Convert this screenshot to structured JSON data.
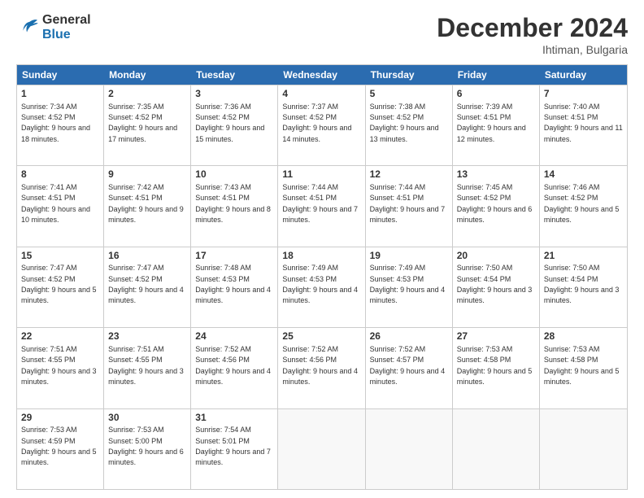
{
  "logo": {
    "line1": "General",
    "line2": "Blue"
  },
  "title": "December 2024",
  "location": "Ihtiman, Bulgaria",
  "days_of_week": [
    "Sunday",
    "Monday",
    "Tuesday",
    "Wednesday",
    "Thursday",
    "Friday",
    "Saturday"
  ],
  "weeks": [
    [
      {
        "day": "1",
        "sunrise": "7:34 AM",
        "sunset": "4:52 PM",
        "daylight": "9 hours and 18 minutes."
      },
      {
        "day": "2",
        "sunrise": "7:35 AM",
        "sunset": "4:52 PM",
        "daylight": "9 hours and 17 minutes."
      },
      {
        "day": "3",
        "sunrise": "7:36 AM",
        "sunset": "4:52 PM",
        "daylight": "9 hours and 15 minutes."
      },
      {
        "day": "4",
        "sunrise": "7:37 AM",
        "sunset": "4:52 PM",
        "daylight": "9 hours and 14 minutes."
      },
      {
        "day": "5",
        "sunrise": "7:38 AM",
        "sunset": "4:52 PM",
        "daylight": "9 hours and 13 minutes."
      },
      {
        "day": "6",
        "sunrise": "7:39 AM",
        "sunset": "4:51 PM",
        "daylight": "9 hours and 12 minutes."
      },
      {
        "day": "7",
        "sunrise": "7:40 AM",
        "sunset": "4:51 PM",
        "daylight": "9 hours and 11 minutes."
      }
    ],
    [
      {
        "day": "8",
        "sunrise": "7:41 AM",
        "sunset": "4:51 PM",
        "daylight": "9 hours and 10 minutes."
      },
      {
        "day": "9",
        "sunrise": "7:42 AM",
        "sunset": "4:51 PM",
        "daylight": "9 hours and 9 minutes."
      },
      {
        "day": "10",
        "sunrise": "7:43 AM",
        "sunset": "4:51 PM",
        "daylight": "9 hours and 8 minutes."
      },
      {
        "day": "11",
        "sunrise": "7:44 AM",
        "sunset": "4:51 PM",
        "daylight": "9 hours and 7 minutes."
      },
      {
        "day": "12",
        "sunrise": "7:44 AM",
        "sunset": "4:51 PM",
        "daylight": "9 hours and 7 minutes."
      },
      {
        "day": "13",
        "sunrise": "7:45 AM",
        "sunset": "4:52 PM",
        "daylight": "9 hours and 6 minutes."
      },
      {
        "day": "14",
        "sunrise": "7:46 AM",
        "sunset": "4:52 PM",
        "daylight": "9 hours and 5 minutes."
      }
    ],
    [
      {
        "day": "15",
        "sunrise": "7:47 AM",
        "sunset": "4:52 PM",
        "daylight": "9 hours and 5 minutes."
      },
      {
        "day": "16",
        "sunrise": "7:47 AM",
        "sunset": "4:52 PM",
        "daylight": "9 hours and 4 minutes."
      },
      {
        "day": "17",
        "sunrise": "7:48 AM",
        "sunset": "4:53 PM",
        "daylight": "9 hours and 4 minutes."
      },
      {
        "day": "18",
        "sunrise": "7:49 AM",
        "sunset": "4:53 PM",
        "daylight": "9 hours and 4 minutes."
      },
      {
        "day": "19",
        "sunrise": "7:49 AM",
        "sunset": "4:53 PM",
        "daylight": "9 hours and 4 minutes."
      },
      {
        "day": "20",
        "sunrise": "7:50 AM",
        "sunset": "4:54 PM",
        "daylight": "9 hours and 3 minutes."
      },
      {
        "day": "21",
        "sunrise": "7:50 AM",
        "sunset": "4:54 PM",
        "daylight": "9 hours and 3 minutes."
      }
    ],
    [
      {
        "day": "22",
        "sunrise": "7:51 AM",
        "sunset": "4:55 PM",
        "daylight": "9 hours and 3 minutes."
      },
      {
        "day": "23",
        "sunrise": "7:51 AM",
        "sunset": "4:55 PM",
        "daylight": "9 hours and 3 minutes."
      },
      {
        "day": "24",
        "sunrise": "7:52 AM",
        "sunset": "4:56 PM",
        "daylight": "9 hours and 4 minutes."
      },
      {
        "day": "25",
        "sunrise": "7:52 AM",
        "sunset": "4:56 PM",
        "daylight": "9 hours and 4 minutes."
      },
      {
        "day": "26",
        "sunrise": "7:52 AM",
        "sunset": "4:57 PM",
        "daylight": "9 hours and 4 minutes."
      },
      {
        "day": "27",
        "sunrise": "7:53 AM",
        "sunset": "4:58 PM",
        "daylight": "9 hours and 5 minutes."
      },
      {
        "day": "28",
        "sunrise": "7:53 AM",
        "sunset": "4:58 PM",
        "daylight": "9 hours and 5 minutes."
      }
    ],
    [
      {
        "day": "29",
        "sunrise": "7:53 AM",
        "sunset": "4:59 PM",
        "daylight": "9 hours and 5 minutes."
      },
      {
        "day": "30",
        "sunrise": "7:53 AM",
        "sunset": "5:00 PM",
        "daylight": "9 hours and 6 minutes."
      },
      {
        "day": "31",
        "sunrise": "7:54 AM",
        "sunset": "5:01 PM",
        "daylight": "9 hours and 7 minutes."
      },
      null,
      null,
      null,
      null
    ]
  ]
}
